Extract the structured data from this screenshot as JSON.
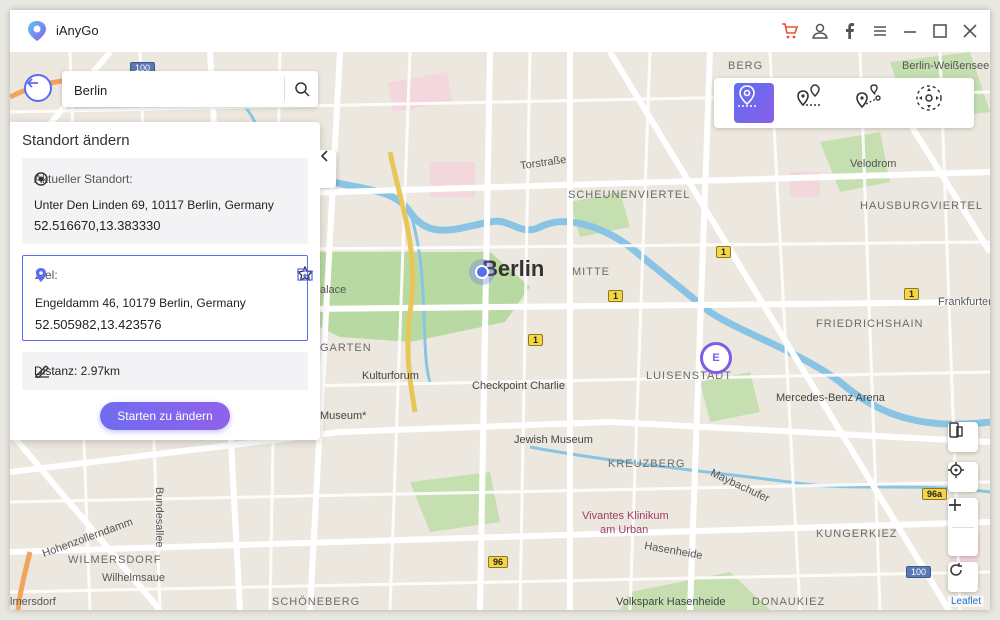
{
  "app": {
    "title": "iAnyGo"
  },
  "titlebar": {
    "icons": [
      "cart-icon",
      "user-icon",
      "facebook-icon",
      "menu-icon",
      "minimize-icon",
      "maximize-icon",
      "close-icon"
    ]
  },
  "search": {
    "value": "Berlin"
  },
  "panel": {
    "title": "Standort ändern",
    "current": {
      "label": "Aktueller Standort:",
      "address": "Unter Den Linden 69, 10117 Berlin, Germany",
      "coords": "52.516670,13.383330"
    },
    "goal": {
      "label": "Ziel:",
      "address": "Engeldamm 46, 10179 Berlin, Germany",
      "coords": "52.505982,13.423576"
    },
    "distance": "Distanz: 2.97km",
    "start_button": "Starten zu ändern"
  },
  "map": {
    "labels": {
      "berlin": "Berlin",
      "torstrasse": "Torstraße",
      "scheunenviertel": "SCHEUNENVIERTEL",
      "mitte": "MITTE",
      "berg": "BERG",
      "berlin_weissensee": "Berlin-Weißensee",
      "velodrom": "Velodrom",
      "hausburgviertel": "HAUSBURGVIERTEL",
      "frankfurter": "Frankfurter",
      "friedrichshain": "FRIEDRICHSHAIN",
      "luisenstadt": "LUISENSTADT",
      "mercedes": "Mercedes-Benz Arena",
      "checkpoint": "Checkpoint Charlie",
      "kulturforum": "Kulturforum",
      "jewish": "Jewish Museum",
      "kreuzberg": "KREUZBERG",
      "vivantes1": "Vivantes Klinikum",
      "vivantes2": "am Urban",
      "hasenheide": "Hasenheide",
      "volkspark": "Volkspark Hasenheide",
      "maybachufer": "Maybachufer",
      "kungerkiez": "KUNGERKIEZ",
      "donaukiez": "DONAUKIEZ",
      "schoeneberg": "SCHÖNEBERG",
      "wilmersdorf": "WILMERSDORF",
      "wilhelmsaue": "Wilhelmsaue",
      "hohenzollerndamm": "Hohenzollerndamm",
      "bundesallee": "Bundesallee",
      "mersdorf": "lmersdorf",
      "alace": "alace",
      "garten": "GARTEN",
      "museum": "Museum*"
    },
    "road_badges": [
      "100",
      "1",
      "1",
      "1",
      "1",
      "96",
      "96a",
      "100"
    ],
    "leaflet": "Leaflet"
  },
  "modes": [
    "teleport-mode-icon",
    "two-spot-mode-icon",
    "multi-spot-mode-icon",
    "joystick-mode-icon"
  ]
}
